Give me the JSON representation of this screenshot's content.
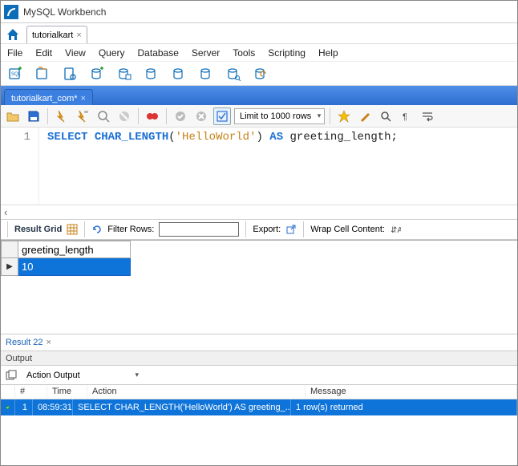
{
  "window": {
    "title": "MySQL Workbench"
  },
  "connection_tab": {
    "label": "tutorialkart"
  },
  "menu": {
    "items": [
      "File",
      "Edit",
      "View",
      "Query",
      "Database",
      "Server",
      "Tools",
      "Scripting",
      "Help"
    ]
  },
  "query_tab": {
    "label": "tutorialkart_com*"
  },
  "editor_toolbar": {
    "limit_label": "Limit to 1000 rows"
  },
  "code": {
    "line_no": "1",
    "tokens": {
      "select": "SELECT",
      "char_length": "CHAR_LENGTH",
      "open": "(",
      "str": "'HelloWorld'",
      "close": ")",
      "as": "AS",
      "alias": "greeting_length",
      "semi": ";"
    }
  },
  "result_toolbar": {
    "label": "Result Grid",
    "filter_label": "Filter Rows:",
    "export_label": "Export:",
    "wrap_label": "Wrap Cell Content:"
  },
  "grid": {
    "columns": [
      "greeting_length"
    ],
    "rows": [
      {
        "greeting_length": "10"
      }
    ]
  },
  "result_tab": {
    "label": "Result 22"
  },
  "output": {
    "header": "Output",
    "selector": "Action Output",
    "columns": {
      "num": "#",
      "time": "Time",
      "action": "Action",
      "message": "Message"
    },
    "rows": [
      {
        "num": "1",
        "time": "08:59:31",
        "action": "SELECT CHAR_LENGTH('HelloWorld') AS greeting_...",
        "message": "1 row(s) returned"
      }
    ]
  }
}
